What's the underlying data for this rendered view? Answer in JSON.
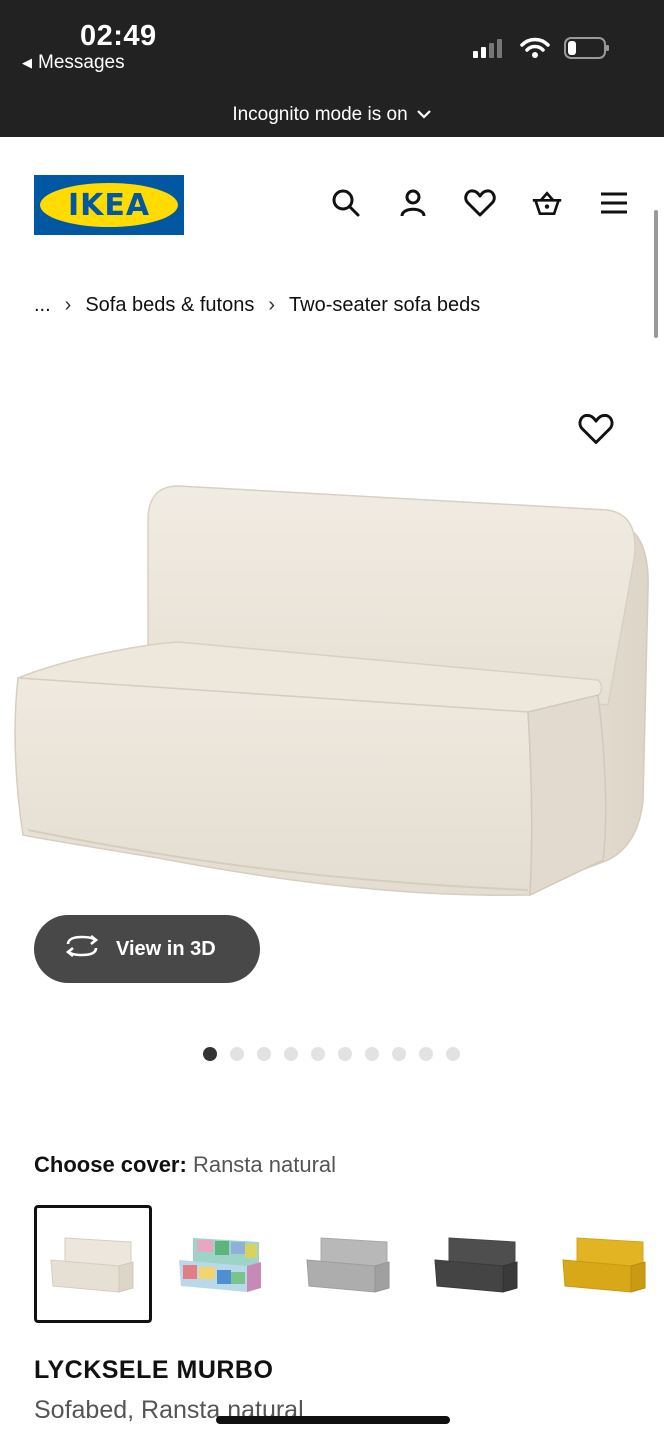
{
  "status_bar": {
    "time": "02:49",
    "back_label": "Messages",
    "incognito_text": "Incognito mode is on"
  },
  "header": {
    "logo_text": "IKEA",
    "icons": [
      "search-icon",
      "account-icon",
      "heart-icon",
      "basket-icon",
      "menu-icon"
    ]
  },
  "breadcrumb": {
    "ellipsis": "...",
    "items": [
      "Sofa beds & futons",
      "Two-seater sofa beds"
    ]
  },
  "gallery": {
    "view3d_label": "View in 3D",
    "dot_count": 10,
    "active_dot": 1
  },
  "cover": {
    "label": "Choose cover:",
    "value": "Ransta natural",
    "options": [
      "Ransta natural",
      "Multicolor",
      "Light grey",
      "Dark grey",
      "Yellow"
    ]
  },
  "product": {
    "name": "LYCKSELE MURBO",
    "description": "Sofabed, Ransta natural"
  },
  "colors": {
    "brand_blue": "#0058a3",
    "brand_yellow": "#ffdb00",
    "status_bar_bg": "#222222"
  }
}
